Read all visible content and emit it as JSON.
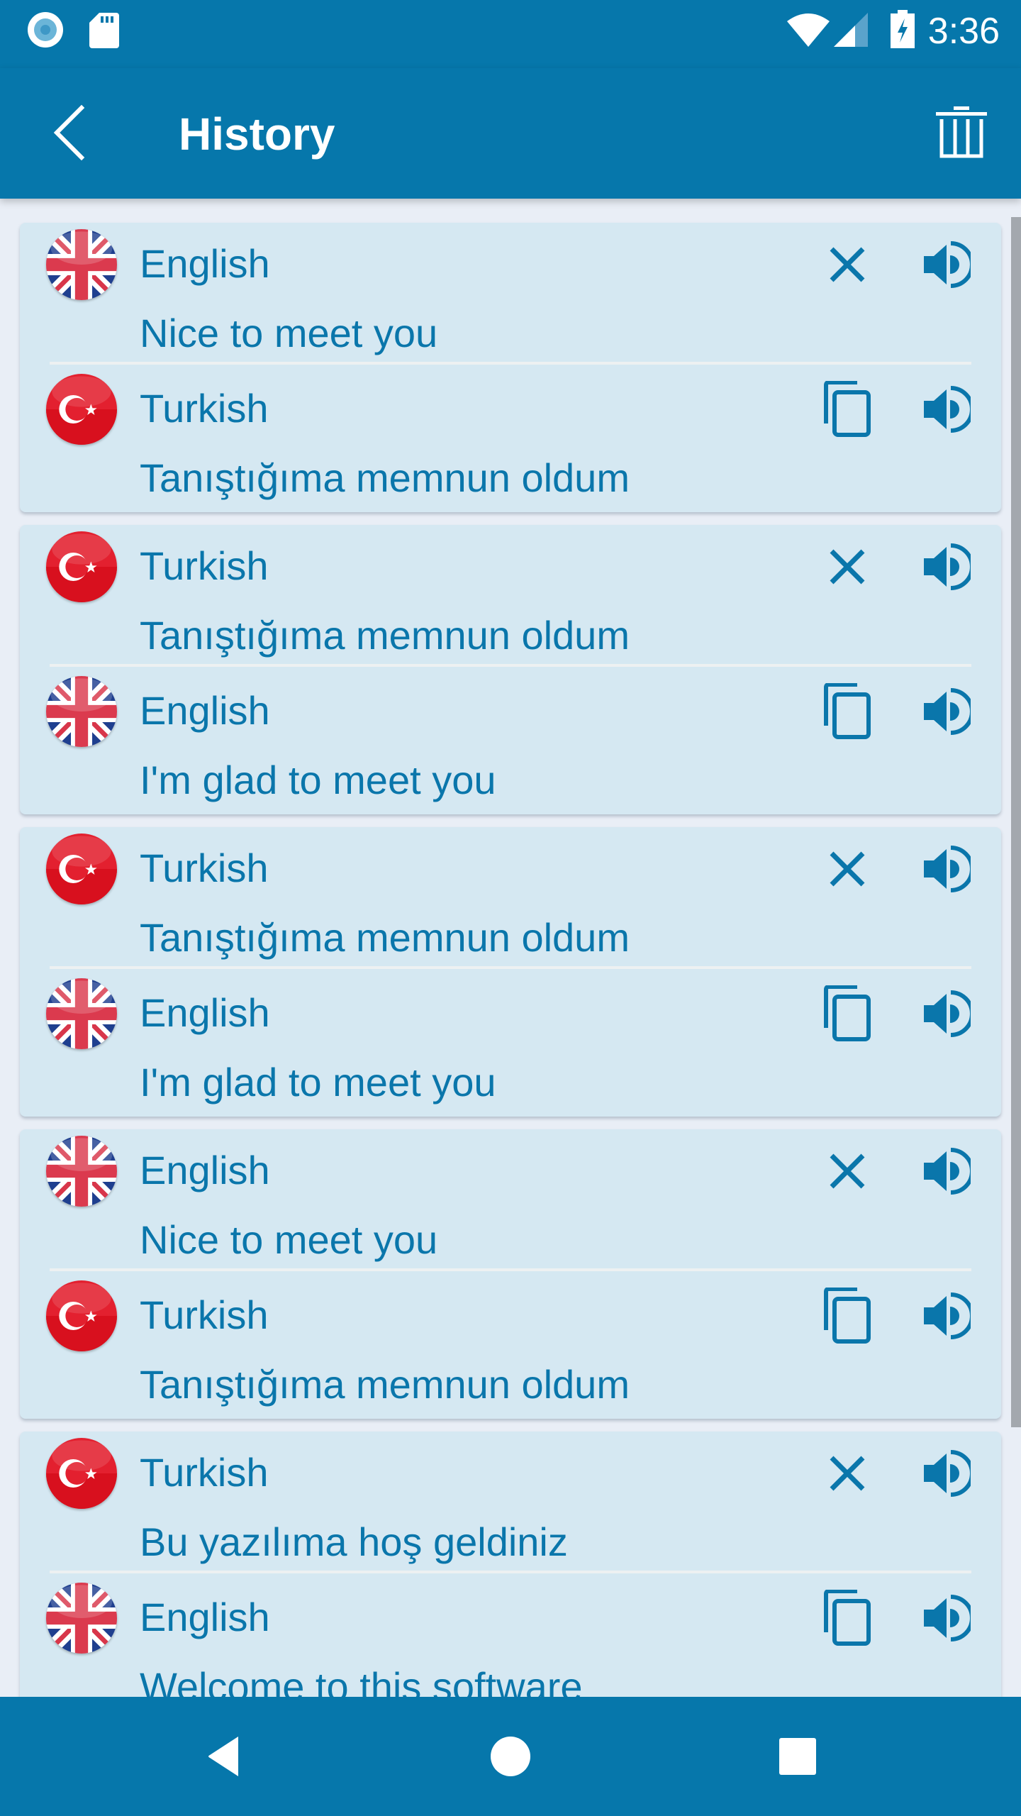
{
  "status_bar": {
    "time": "3:36",
    "left_icons": [
      "sync-circle-icon",
      "sd-card-icon"
    ],
    "right_icons": [
      "wifi-icon",
      "cell-signal-icon",
      "battery-charging-icon"
    ]
  },
  "app_bar": {
    "title": "History",
    "back_icon": "chevron-left-icon",
    "delete_all_icon": "trash-icon"
  },
  "colors": {
    "primary": "#0677AB",
    "text": "#0A76AB",
    "card_bg": "#D5E8F2",
    "list_bg": "#E9EEF6"
  },
  "history": [
    {
      "source": {
        "language": "English",
        "flag": "uk",
        "text": "Nice to meet you"
      },
      "target": {
        "language": "Turkish",
        "flag": "tr",
        "text": "Tanıştığıma memnun oldum"
      }
    },
    {
      "source": {
        "language": "Turkish",
        "flag": "tr",
        "text": "Tanıştığıma memnun oldum"
      },
      "target": {
        "language": "English",
        "flag": "uk",
        "text": "I'm glad to meet you"
      }
    },
    {
      "source": {
        "language": "Turkish",
        "flag": "tr",
        "text": "Tanıştığıma memnun oldum"
      },
      "target": {
        "language": "English",
        "flag": "uk",
        "text": "I'm glad to meet you"
      }
    },
    {
      "source": {
        "language": "English",
        "flag": "uk",
        "text": "Nice to meet you"
      },
      "target": {
        "language": "Turkish",
        "flag": "tr",
        "text": "Tanıştığıma memnun oldum"
      }
    },
    {
      "source": {
        "language": "Turkish",
        "flag": "tr",
        "text": "Bu yazılıma hoş geldiniz"
      },
      "target": {
        "language": "English",
        "flag": "uk",
        "text": "Welcome to this software"
      }
    }
  ],
  "nav_bar": {
    "icons": [
      "nav-back-icon",
      "nav-home-icon",
      "nav-recents-icon"
    ]
  }
}
